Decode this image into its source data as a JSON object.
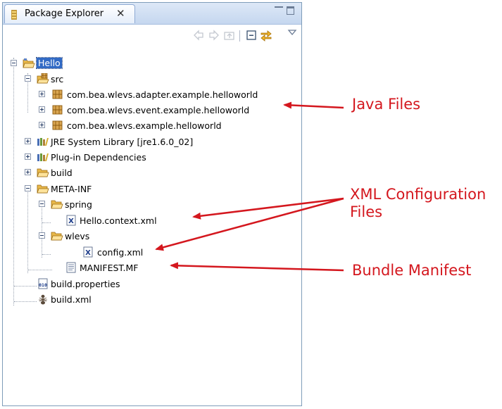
{
  "view": {
    "tab_title": "Package Explorer",
    "tab_close": "✕"
  },
  "tree": {
    "project": "Hello",
    "src": "src",
    "packages": [
      "com.bea.wlevs.adapter.example.helloworld",
      "com.bea.wlevs.event.example.helloworld",
      "com.bea.wlevs.example.helloworld"
    ],
    "jre": "JRE System Library [jre1.6.0_02]",
    "plugin_deps": "Plug-in Dependencies",
    "build": "build",
    "meta_inf": "META-INF",
    "spring": "spring",
    "hello_context": "Hello.context.xml",
    "wlevs": "wlevs",
    "config": "config.xml",
    "manifest": "MANIFEST.MF",
    "build_properties": "build.properties",
    "build_xml": "build.xml"
  },
  "annotations": {
    "java_files": "Java Files",
    "xml_line1": "XML Configuration",
    "xml_line2": "Files",
    "bundle_manifest": "Bundle Manifest"
  },
  "colors": {
    "annotation": "#d4171e",
    "selection": "#316ac5",
    "folder": "#e8b84a"
  }
}
